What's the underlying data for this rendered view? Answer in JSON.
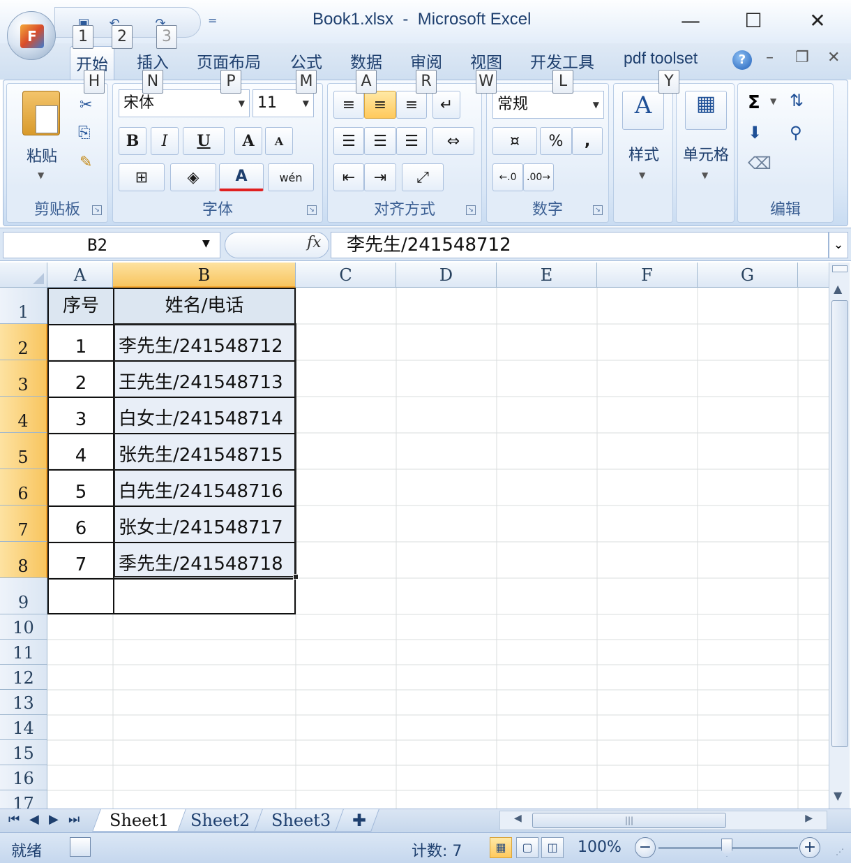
{
  "window": {
    "title": "Book1.xlsx  -  Microsoft Excel",
    "office_button_letter": "F",
    "minimize": "—",
    "maximize": "☐",
    "close": "✕"
  },
  "quick_access": {
    "keytips": [
      "1",
      "2",
      "3"
    ],
    "more": "="
  },
  "tabs": [
    {
      "label": "开始",
      "keytip": "H"
    },
    {
      "label": "插入",
      "keytip": "N"
    },
    {
      "label": "页面布局",
      "keytip": "P"
    },
    {
      "label": "公式",
      "keytip": "M"
    },
    {
      "label": "数据",
      "keytip": "A"
    },
    {
      "label": "审阅",
      "keytip": "R"
    },
    {
      "label": "视图",
      "keytip": "W"
    },
    {
      "label": "开发工具",
      "keytip": "L"
    },
    {
      "label": "pdf toolset",
      "keytip": "Y"
    }
  ],
  "ribbon": {
    "clipboard": {
      "label": "剪贴板",
      "paste": "粘贴"
    },
    "font": {
      "label": "字体",
      "font_name": "宋体",
      "font_size": "11",
      "bold": "B",
      "italic": "I",
      "underline": "U",
      "grow": "A",
      "shrink": "A",
      "font_color": "A",
      "phonetic": "wén"
    },
    "alignment": {
      "label": "对齐方式"
    },
    "number": {
      "label": "数字",
      "format": "常规",
      "percent": "%",
      "comma": ","
    },
    "styles": {
      "label": "样式"
    },
    "cells": {
      "label": "单元格"
    },
    "editing": {
      "label": "编辑",
      "sum": "Σ"
    }
  },
  "formula_bar": {
    "name_box": "B2",
    "fx": "fx",
    "value": "李先生/241548712"
  },
  "sheet": {
    "columns": [
      "A",
      "B",
      "C",
      "D",
      "E",
      "F",
      "G"
    ],
    "row_numbers": [
      "1",
      "2",
      "3",
      "4",
      "5",
      "6",
      "7",
      "8",
      "9",
      "10",
      "11",
      "12",
      "13",
      "14",
      "15",
      "16",
      "17"
    ],
    "header": [
      "序号",
      "姓名/电话"
    ],
    "rows": [
      [
        "1",
        "李先生/241548712"
      ],
      [
        "2",
        "王先生/241548713"
      ],
      [
        "3",
        "白女士/241548714"
      ],
      [
        "4",
        "张先生/241548715"
      ],
      [
        "5",
        "白先生/241548716"
      ],
      [
        "6",
        "张女士/241548717"
      ],
      [
        "7",
        "季先生/241548718"
      ]
    ]
  },
  "sheet_tabs": [
    "Sheet1",
    "Sheet2",
    "Sheet3"
  ],
  "status": {
    "ready": "就绪",
    "count": "计数: 7",
    "zoom": "100%"
  },
  "colors": {
    "selection_header": "#f8c55f",
    "ribbon_blue": "#dde9f7"
  }
}
